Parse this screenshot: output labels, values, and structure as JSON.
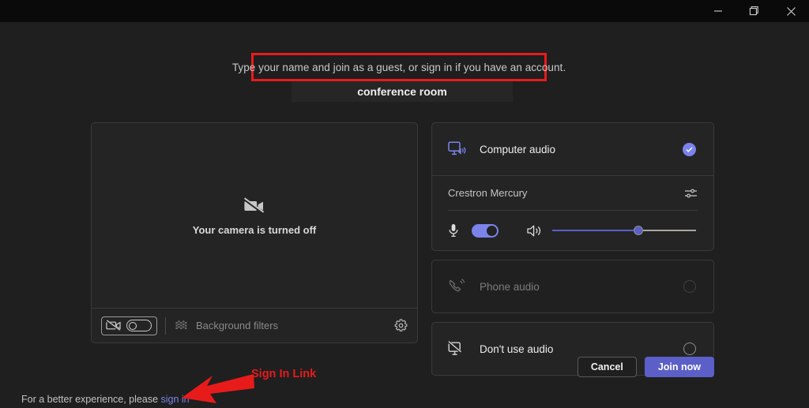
{
  "window": {
    "controls": [
      {
        "name": "minimize",
        "glyph": "minimize-icon"
      },
      {
        "name": "restore",
        "glyph": "restore-icon"
      },
      {
        "name": "close",
        "glyph": "close-icon"
      }
    ]
  },
  "header": {
    "subtitle": "Type your name and join as a guest, or sign in if you have an account.",
    "name_value": "conference room",
    "name_placeholder": "Type your name"
  },
  "video": {
    "camera_off_text": "Your camera is turned off",
    "camera_off_icon": "camera-off-icon",
    "camera_toggle_label": "camera-toggle",
    "camera_toggle_on": false,
    "background_filters_label": "Background filters",
    "background_filters_icon": "background-filters-icon",
    "settings_icon": "gear-icon"
  },
  "audio": {
    "options": [
      {
        "label": "Computer audio",
        "icon": "computer-audio-icon",
        "selected": true,
        "disabled": false
      },
      {
        "label": "Phone audio",
        "icon": "phone-audio-icon",
        "selected": false,
        "disabled": true
      },
      {
        "label": "Don't use audio",
        "icon": "no-audio-icon",
        "selected": false,
        "disabled": false
      }
    ],
    "device": {
      "name": "Crestron Mercury",
      "settings_icon": "device-settings-icon",
      "mic_icon": "microphone-icon",
      "mic_on": true,
      "speaker_icon": "speaker-icon",
      "volume_percent": 60
    }
  },
  "footer": {
    "cancel_label": "Cancel",
    "join_label": "Join now"
  },
  "signin": {
    "text": "For a better experience, please ",
    "link": "sign in"
  },
  "annotations": {
    "signin_arrow_label": "Sign In Link",
    "highlight_color": "#e81b1b"
  },
  "colors": {
    "accent": "#5b5fc7",
    "accent_light": "#7b83eb",
    "background": "#1f1f1f",
    "panel": "#242424",
    "titlebar": "#0a0a0a",
    "annotation_red": "#e81b1b"
  }
}
